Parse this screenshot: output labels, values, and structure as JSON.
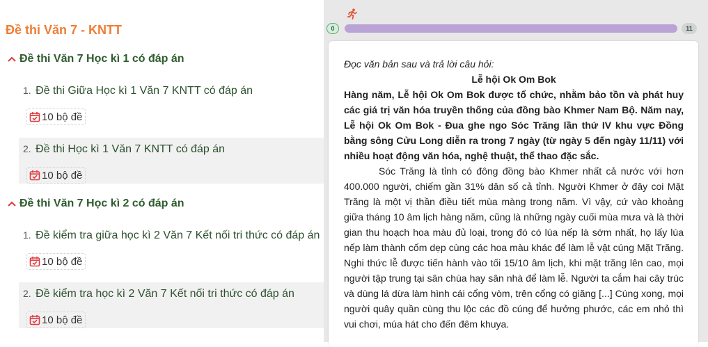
{
  "sidebar": {
    "title": "Đề thi Văn 7 - KNTT",
    "sections": [
      {
        "label": "Đề thi Văn 7 Học kì 1 có đáp án",
        "items": [
          {
            "num": "1.",
            "title": "Đề thi Giữa Học kì 1 Văn 7 KNTT có đáp án",
            "badge": "10 bộ đề"
          },
          {
            "num": "2.",
            "title": "Đề thi Học kì 1 Văn 7 KNTT có đáp án",
            "badge": "10 bộ đề"
          }
        ]
      },
      {
        "label": "Đề thi Văn 7 Học kì 2 có đáp án",
        "items": [
          {
            "num": "1.",
            "title": "Đề kiểm tra giữa học kì 2 Văn 7 Kết nối tri thức có đáp án",
            "badge": "10 bộ đề"
          },
          {
            "num": "2.",
            "title": "Đề kiểm tra học kì 2 Văn 7 Kết nối tri thức có đáp án",
            "badge": "10 bộ đề"
          }
        ]
      }
    ]
  },
  "progress": {
    "current": "0",
    "total": "11",
    "fill_fraction": 0.0,
    "icon": "running-person-icon",
    "colors": {
      "track": "#b9a3d7",
      "runner": "#e2502c",
      "accent": "#ef7d33",
      "section": "#2f5b2f"
    }
  },
  "passage": {
    "intro": "Đọc văn bản sau và trả lời câu hỏi:",
    "title": "Lễ hội Ok Om Bok",
    "lead": "Hàng năm, Lễ hội Ok Om Bok được tổ chức, nhằm bảo tồn và phát huy các giá trị văn hóa truyền thống của đồng bào Khmer Nam Bộ. Năm nay, Lễ hội Ok Om Bok - Đua ghe ngo Sóc Trăng lần thứ IV khu vực Đồng bằng sông Cửu Long diễn ra trong 7 ngày (từ ngày 5 đến ngày 11/11) với nhiều hoạt động văn hóa, nghệ thuật, thể thao đặc sắc.",
    "body": "Sóc Trăng là tỉnh có đông đồng bào Khmer nhất cả nước với hơn 400.000 người, chiếm gần 31% dân số cả tỉnh. Người Khmer ở đây coi Mặt Trăng là một vị thần điều tiết mùa màng trong năm. Vì vậy, cứ vào khoảng giữa tháng 10 âm lịch hàng năm, cũng là những ngày cuối mùa mưa và là thời gian thu hoạch hoa màu đủ loại, trong đó có lúa nếp là sớm nhất, họ lấy lúa nếp làm thành cốm dẹp cùng các hoa màu khác để làm lễ vật cúng Mặt Trăng. Nghi thức lễ được tiến hành vào tối 15/10 âm lịch, khi mặt trăng lên cao, mọi người tập trung tại sân chùa hay sân nhà để làm lễ. Người ta cắm hai cây trúc và dùng lá dừa làm hình cái cổng vòm, trên cổng có giăng [...] Cúng xong, mọi người quây quần cùng thu lộc các đồ cúng để hưởng phước, các em nhỏ thì vui chơi, múa hát cho đến đêm khuya."
  }
}
